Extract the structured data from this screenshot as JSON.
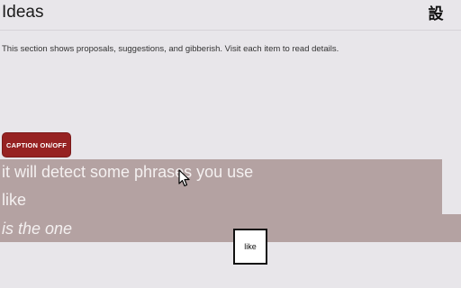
{
  "header": {
    "title": "Ideas",
    "settings_glyph": "設",
    "settings_icon": "settings-kanji-icon"
  },
  "main": {
    "description": "This section shows proposals, suggestions, and gibberish. Visit each item to read details.",
    "caption_toggle_label": "CAPTION ON/OFF"
  },
  "captions": {
    "lines": [
      "it will detect some phrases you use",
      "like",
      "is the one"
    ]
  },
  "tooltip": {
    "text": "like"
  },
  "colors": {
    "background": "#e8e6ea",
    "caption_button": "#962222",
    "caption_panel": "#b4a2a2",
    "caption_text": "#f4f0f0"
  }
}
